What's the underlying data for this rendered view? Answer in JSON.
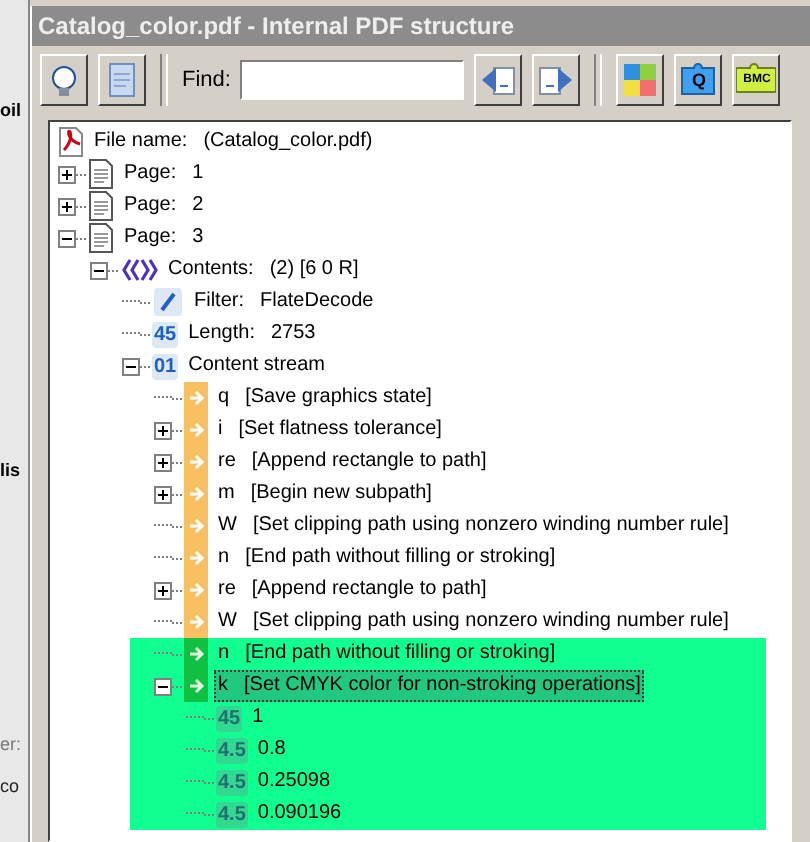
{
  "background_window": {
    "fragments": [
      "oil",
      "lis",
      "er:",
      "co"
    ]
  },
  "window": {
    "title": "Catalog_color.pdf - Internal PDF structure"
  },
  "toolbar": {
    "left_buttons": [
      {
        "kind": "bulb"
      },
      {
        "kind": "document"
      }
    ],
    "find": {
      "label": "Find:"
    },
    "nav_buttons": [
      {
        "kind": "previous"
      },
      {
        "kind": "next"
      }
    ],
    "view_buttons": [
      {
        "kind": "puzzle"
      },
      {
        "kind": "puzzle-q",
        "text": "Q"
      },
      {
        "kind": "puzzle-tag",
        "text": "BMC"
      }
    ]
  },
  "tree": [
    {
      "kind": "pdf",
      "name": "File name:",
      "value": "(Catalog_color.pdf)",
      "selected": false,
      "highlighted": false
    },
    {
      "kind": "page",
      "name": "Page:",
      "value": "1",
      "expanded": false,
      "selected": false,
      "highlighted": false
    },
    {
      "kind": "page",
      "name": "Page:",
      "value": "2",
      "expanded": false,
      "selected": false,
      "highlighted": false
    },
    {
      "kind": "page",
      "name": "Page:",
      "value": "3",
      "expanded": true,
      "selected": false,
      "highlighted": false,
      "children": [
        {
          "kind": "stream",
          "name": "Contents:",
          "value": "(2) [6 0 R]",
          "expanded": true,
          "selected": false,
          "highlighted": false,
          "children": [
            {
              "kind": "filter",
              "name": "Filter:",
              "value": "FlateDecode",
              "selected": false,
              "highlighted": false
            },
            {
              "kind": "number",
              "badge": "45",
              "name": "Length:",
              "value": "2753",
              "selected": false,
              "highlighted": false
            },
            {
              "kind": "number",
              "badge": "01",
              "name": "Content stream",
              "expanded": true,
              "selected": false,
              "highlighted": false,
              "children": [
                {
                  "kind": "operator",
                  "name": "q",
                  "value": "[Save graphics state]",
                  "selected": false,
                  "highlighted": false
                },
                {
                  "kind": "operator",
                  "name": "i",
                  "value": "[Set flatness tolerance]",
                  "expanded": false,
                  "selected": false,
                  "highlighted": false
                },
                {
                  "kind": "operator",
                  "name": "re",
                  "value": "[Append rectangle to path]",
                  "expanded": false,
                  "selected": false,
                  "highlighted": false
                },
                {
                  "kind": "operator",
                  "name": "m",
                  "value": "[Begin new subpath]",
                  "expanded": false,
                  "selected": false,
                  "highlighted": false
                },
                {
                  "kind": "operator",
                  "name": "W",
                  "value": "[Set clipping path using nonzero winding number rule]",
                  "selected": false,
                  "highlighted": false
                },
                {
                  "kind": "operator",
                  "name": "n",
                  "value": "[End path without filling or stroking]",
                  "selected": false,
                  "highlighted": false
                },
                {
                  "kind": "operator",
                  "name": "re",
                  "value": "[Append rectangle to path]",
                  "expanded": false,
                  "selected": false,
                  "highlighted": false
                },
                {
                  "kind": "operator",
                  "name": "W",
                  "value": "[Set clipping path using nonzero winding number rule]",
                  "selected": false,
                  "highlighted": false
                },
                {
                  "kind": "operator",
                  "name": "n",
                  "value": "[End path without filling or stroking]",
                  "selected": false,
                  "highlighted": true
                },
                {
                  "kind": "operator",
                  "name": "k",
                  "value": "[Set CMYK color for non-stroking operations]",
                  "expanded": true,
                  "selected": true,
                  "highlighted": true,
                  "children": [
                    {
                      "kind": "number",
                      "badge": "45",
                      "name": "1",
                      "selected": false,
                      "highlighted": true
                    },
                    {
                      "kind": "number",
                      "badge": "4.5",
                      "name": "0.8",
                      "selected": false,
                      "highlighted": true
                    },
                    {
                      "kind": "number",
                      "badge": "4.5",
                      "name": "0.25098",
                      "selected": false,
                      "highlighted": true
                    },
                    {
                      "kind": "number",
                      "badge": "4.5",
                      "name": "0.090196",
                      "selected": false,
                      "highlighted": true
                    }
                  ]
                }
              ]
            }
          ]
        }
      ]
    }
  ]
}
